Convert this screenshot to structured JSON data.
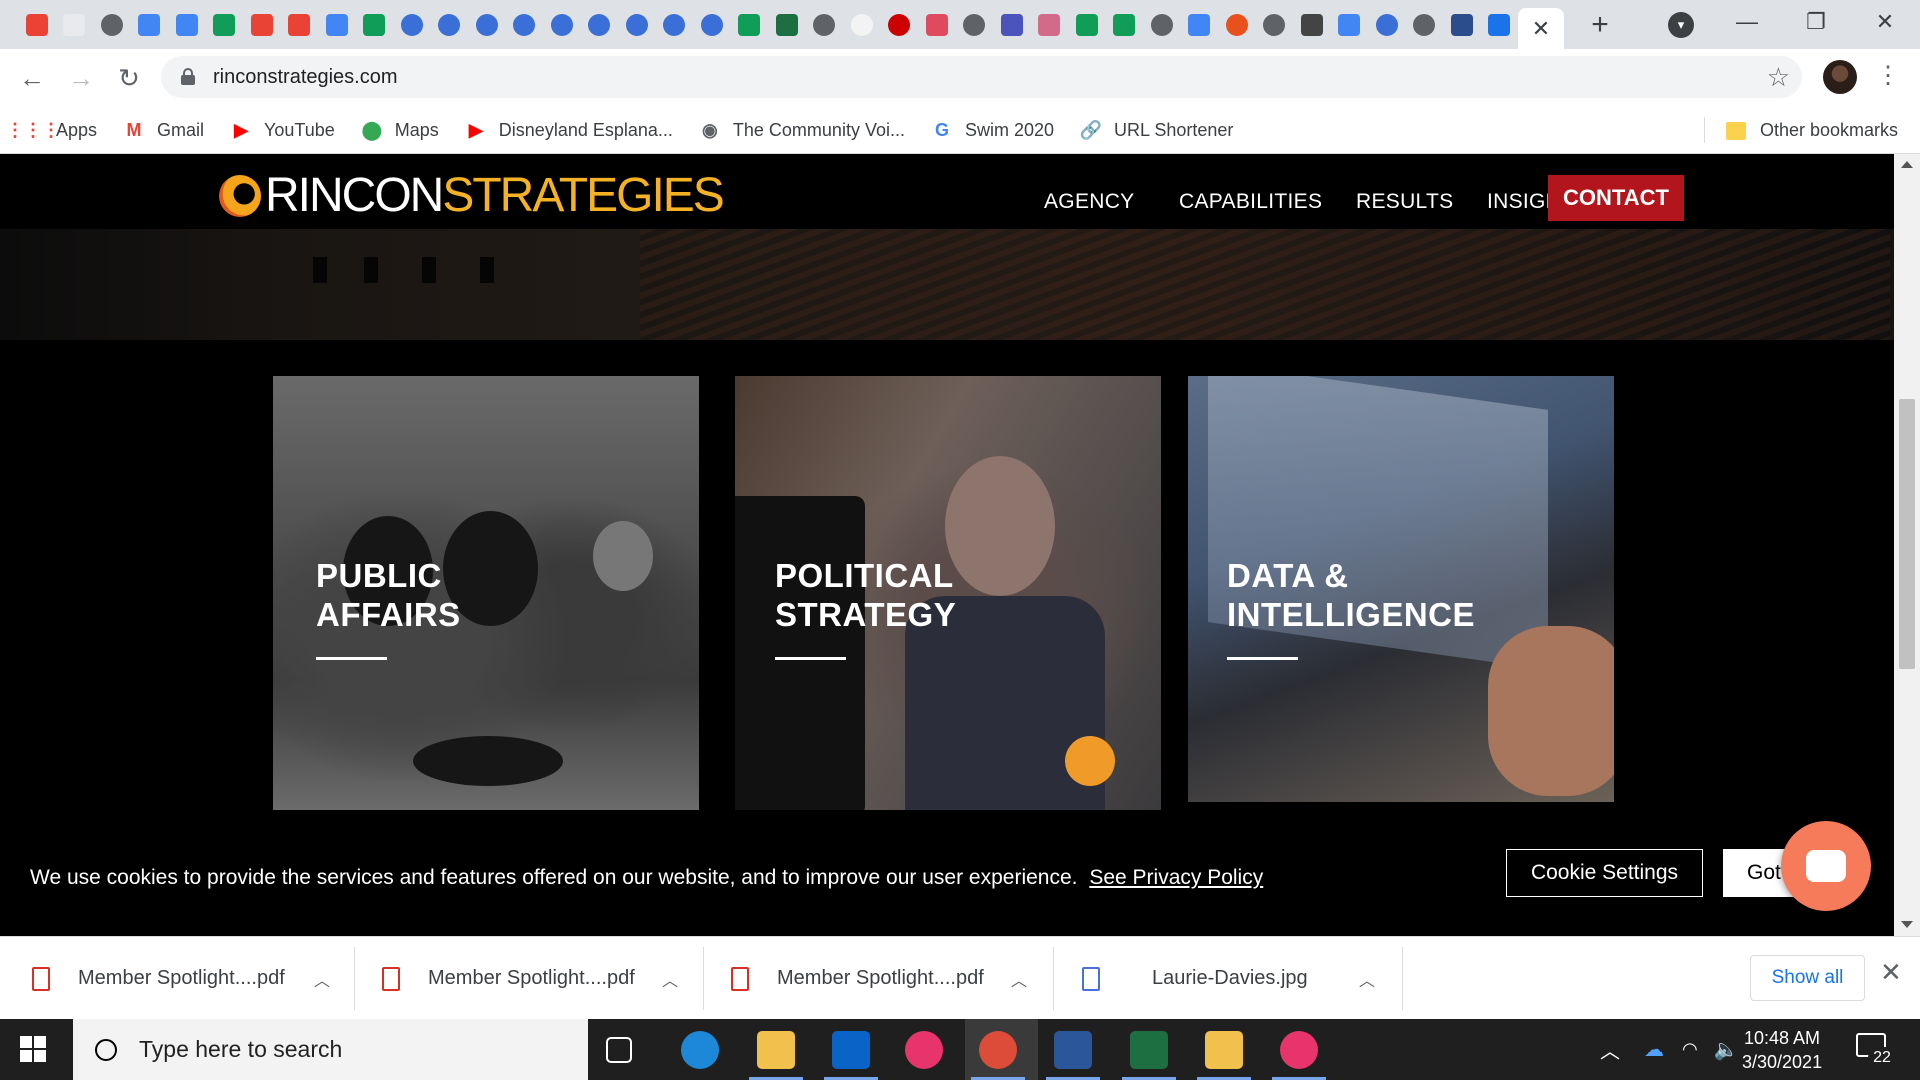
{
  "browser": {
    "tab_favicons": [
      {
        "name": "gmail-icon",
        "color": "#ea4335"
      },
      {
        "name": "blank-doc-icon",
        "color": "#e8eaed"
      },
      {
        "name": "globe-icon",
        "color": "#5f6368",
        "round": true
      },
      {
        "name": "google-docs-icon",
        "color": "#4285f4"
      },
      {
        "name": "google-docs-icon",
        "color": "#4285f4"
      },
      {
        "name": "google-sheets-icon",
        "color": "#0f9d58"
      },
      {
        "name": "gmail-icon",
        "color": "#ea4335"
      },
      {
        "name": "gmail-icon",
        "color": "#ea4335"
      },
      {
        "name": "google-docs-icon",
        "color": "#4285f4"
      },
      {
        "name": "google-sheets-icon",
        "color": "#0f9d58"
      },
      {
        "name": "c-circle-icon",
        "color": "#3a6fd8",
        "round": true
      },
      {
        "name": "c-circle-icon",
        "color": "#3a6fd8",
        "round": true
      },
      {
        "name": "c-circle-icon",
        "color": "#3a6fd8",
        "round": true
      },
      {
        "name": "c-circle-icon",
        "color": "#3a6fd8",
        "round": true
      },
      {
        "name": "c-circle-icon",
        "color": "#3a6fd8",
        "round": true
      },
      {
        "name": "c-circle-icon",
        "color": "#3a6fd8",
        "round": true
      },
      {
        "name": "c-circle-icon",
        "color": "#3a6fd8",
        "round": true
      },
      {
        "name": "c-circle-icon",
        "color": "#3a6fd8",
        "round": true
      },
      {
        "name": "c-circle-icon",
        "color": "#3a6fd8",
        "round": true
      },
      {
        "name": "google-sheets-icon",
        "color": "#0f9d58"
      },
      {
        "name": "excel-icon",
        "color": "#1d6f42"
      },
      {
        "name": "globe-icon",
        "color": "#5f6368",
        "round": true
      },
      {
        "name": "k-logo-icon",
        "color": "#f3f3f3",
        "round": true
      },
      {
        "name": "target-icon",
        "color": "#cc0000",
        "round": true
      },
      {
        "name": "sh-logo-icon",
        "color": "#e04a5f"
      },
      {
        "name": "globe-icon",
        "color": "#5f6368",
        "round": true
      },
      {
        "name": "teams-icon",
        "color": "#4b53bc"
      },
      {
        "name": "cupcake-icon",
        "color": "#d36a8a"
      },
      {
        "name": "google-sheets-icon",
        "color": "#0f9d58"
      },
      {
        "name": "google-sheets-icon",
        "color": "#0f9d58"
      },
      {
        "name": "seal-icon",
        "color": "#5f6368",
        "round": true
      },
      {
        "name": "google-docs-icon",
        "color": "#4285f4"
      },
      {
        "name": "e-logo-icon",
        "color": "#e8501c",
        "round": true
      },
      {
        "name": "seal-icon",
        "color": "#5f6368",
        "round": true
      },
      {
        "name": "cube-icon",
        "color": "#444444"
      },
      {
        "name": "google-docs-icon",
        "color": "#4285f4"
      },
      {
        "name": "chrome-swirl-icon",
        "color": "#3a6fd8",
        "round": true
      },
      {
        "name": "seal-icon",
        "color": "#5f6368",
        "round": true
      },
      {
        "name": "check-marks-icon",
        "color": "#2b4d8c"
      },
      {
        "name": "s-logo-icon",
        "color": "#1a73e8"
      }
    ],
    "active_tab_close": "✕",
    "new_tab": "+",
    "url": "rinconstrategies.com",
    "bookmarks": [
      {
        "label": "Apps",
        "icon": "apps-grid-icon",
        "color": "#ea4335",
        "glyph": "⋮⋮⋮"
      },
      {
        "label": "Gmail",
        "icon": "gmail-icon",
        "color": "#ea4335",
        "glyph": "M"
      },
      {
        "label": "YouTube",
        "icon": "youtube-icon",
        "color": "#ff0000",
        "glyph": "▶"
      },
      {
        "label": "Maps",
        "icon": "maps-pin-icon",
        "color": "#34a853",
        "glyph": "⬤"
      },
      {
        "label": "Disneyland Esplana...",
        "icon": "youtube-icon",
        "color": "#ff0000",
        "glyph": "▶"
      },
      {
        "label": "The Community Voi...",
        "icon": "globe-icon",
        "color": "#5f6368",
        "glyph": "◉"
      },
      {
        "label": "Swim 2020",
        "icon": "google-icon",
        "color": "#4285f4",
        "glyph": "G"
      },
      {
        "label": "URL Shortener",
        "icon": "link-icon",
        "color": "#1a73e8",
        "glyph": "🔗"
      }
    ],
    "other_bookmarks": "Other bookmarks"
  },
  "site": {
    "logo_part1": "RINCON",
    "logo_part2": "STRATEGIES",
    "nav": [
      "AGENCY",
      "CAPABILITIES",
      "RESULTS",
      "INSIGHT"
    ],
    "nav_contact": "CONTACT",
    "cards": [
      {
        "title": "PUBLIC\nAFFAIRS"
      },
      {
        "title": "POLITICAL\nSTRATEGY"
      },
      {
        "title": "DATA &\nINTELLIGENCE"
      }
    ],
    "cookie": {
      "text": "We use cookies to provide the services and features offered on our website, and to improve our user experience.",
      "link": "See Privacy Policy",
      "settings_button": "Cookie Settings",
      "accept_button": "Got it"
    }
  },
  "downloads": {
    "items": [
      {
        "name": "Member Spotlight....pdf",
        "type": "pdf"
      },
      {
        "name": "Member Spotlight....pdf",
        "type": "pdf"
      },
      {
        "name": "Member Spotlight....pdf",
        "type": "pdf"
      },
      {
        "name": "Laurie-Davies.jpg",
        "type": "jpg"
      }
    ],
    "show_all": "Show all"
  },
  "taskbar": {
    "search_placeholder": "Type here to search",
    "apps": [
      {
        "name": "task-view-icon",
        "color": "#ffffff"
      },
      {
        "name": "edge-icon",
        "color": "#1e88d8"
      },
      {
        "name": "file-explorer-icon",
        "color": "#f2c04c"
      },
      {
        "name": "outlook-icon",
        "color": "#0a64c8"
      },
      {
        "name": "creative-cloud-icon",
        "color": "#e8346c"
      },
      {
        "name": "chrome-icon",
        "color": "#dd4b39"
      },
      {
        "name": "word-icon",
        "color": "#2b579a"
      },
      {
        "name": "excel-icon",
        "color": "#1d6f42"
      },
      {
        "name": "file-sync-icon",
        "color": "#f2c04c"
      },
      {
        "name": "creative-cloud-icon",
        "color": "#e8346c"
      }
    ],
    "time": "10:48 AM",
    "date": "3/30/2021",
    "notification_count": "22"
  }
}
